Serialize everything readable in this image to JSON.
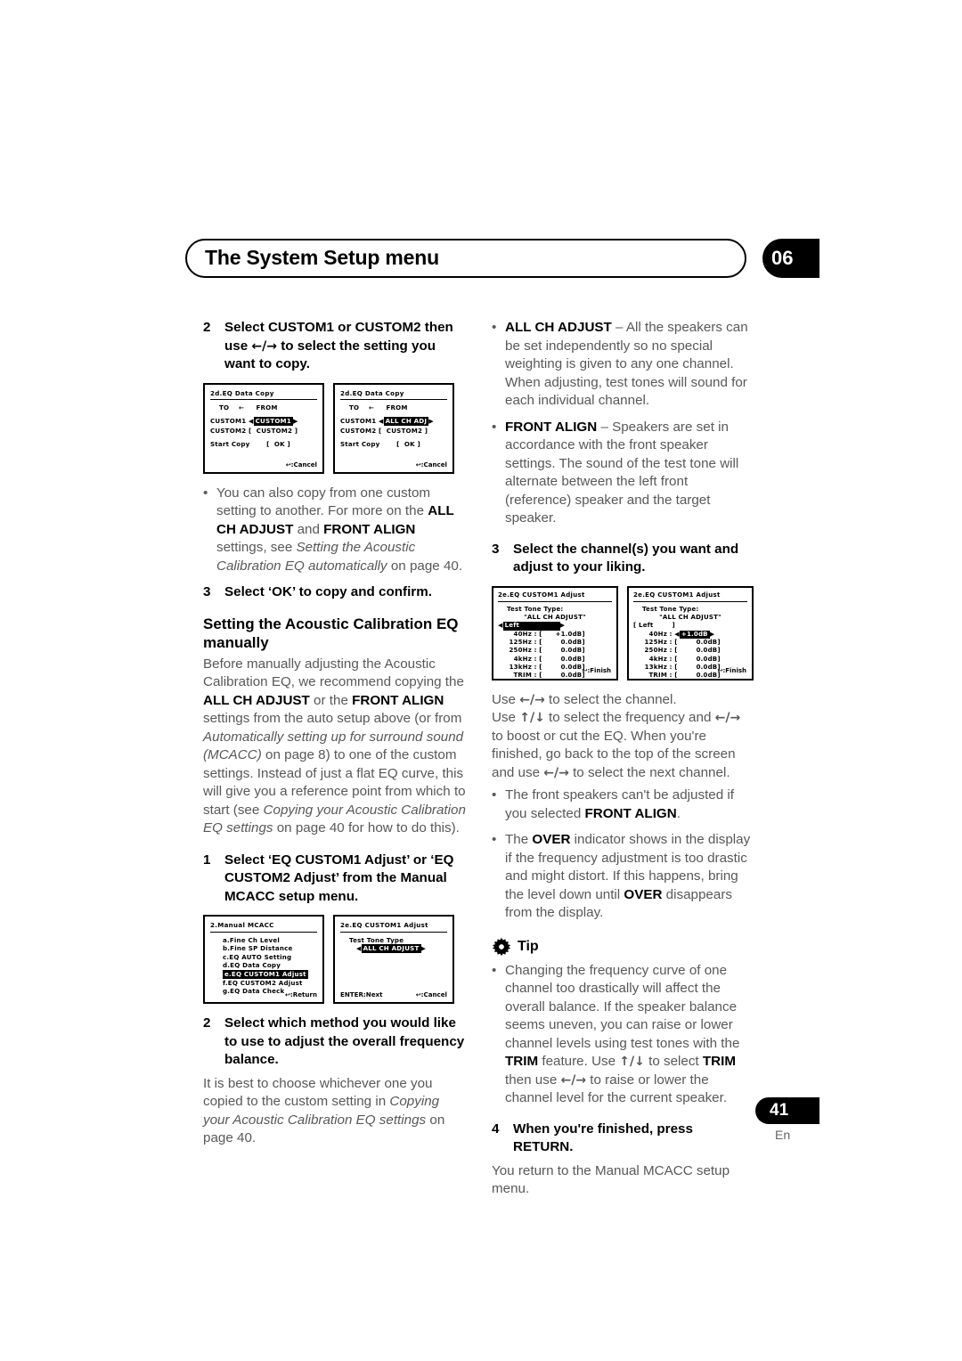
{
  "header": {
    "title": "The System Setup menu",
    "chapter": "06"
  },
  "footer": {
    "page_number": "41",
    "language": "En"
  },
  "left_column": {
    "step2": {
      "number": "2",
      "text_a": "Select CUSTOM1 or CUSTOM2 then use ",
      "arrows": "←/→",
      "text_b": " to select the setting you want to copy."
    },
    "figure_eq_data_copy": {
      "screen1": {
        "title": "2d.EQ Data Copy",
        "header_row": "TO    ←     FROM",
        "row1_label": "CUSTOM1",
        "row1_value": "CUSTOM1",
        "row2_label": "CUSTOM2",
        "row2_value": "CUSTOM2",
        "start_label": "Start Copy",
        "start_value": "OK",
        "footer": "↩:Cancel"
      },
      "screen2": {
        "title": "2d.EQ Data Copy",
        "header_row": "TO    ←     FROM",
        "row1_label": "CUSTOM1",
        "row1_value": "ALL CH ADJ",
        "row2_label": "CUSTOM2",
        "row2_value": "CUSTOM2",
        "start_label": "Start Copy",
        "start_value": "OK",
        "footer": "↩:Cancel"
      }
    },
    "bullet1": {
      "part1": "You can also copy from one custom setting to another. For more on the ",
      "bold1": "ALL CH ADJUST",
      "part2": " and ",
      "bold2": "FRONT ALIGN",
      "part3": " settings, see ",
      "italic1": "Setting the Acoustic Calibration EQ automatically",
      "part4": " on page 40."
    },
    "step3": {
      "number": "3",
      "text": "Select ‘OK’ to copy and confirm."
    },
    "heading_manual": "Setting the Acoustic Calibration EQ manually",
    "body_manual": {
      "part1": "Before manually adjusting the Acoustic Calibration EQ, we recommend copying the ",
      "bold1": "ALL CH ADJUST",
      "part2": " or the ",
      "bold2": "FRONT ALIGN",
      "part3": " settings from the auto setup above (or from ",
      "italic1": "Automatically setting up for surround sound (MCACC)",
      "part4": " on page 8) to one of the custom settings. Instead of just a flat EQ curve, this will give you a reference point from which to start (see ",
      "italic2": "Copying your Acoustic Calibration EQ settings",
      "part5": " on page 40 for how to do this)."
    },
    "step1b": {
      "number": "1",
      "text": "Select ‘EQ CUSTOM1 Adjust’ or ‘EQ CUSTOM2 Adjust’ from the Manual MCACC setup menu."
    },
    "figure_manual_mcacc": {
      "screen1": {
        "title": "2.Manual MCACC",
        "items": [
          "a.Fine Ch Level",
          "b.Fine SP Distance",
          "c.EQ AUTO Setting",
          "d.EQ Data Copy",
          "e.EQ CUSTOM1 Adjust",
          "f.EQ CUSTOM2 Adjust",
          "g.EQ Data Check"
        ],
        "selected_index": 4,
        "footer": "↩:Return"
      },
      "screen2": {
        "title": "2e.EQ CUSTOM1 Adjust",
        "label": "Test Tone Type",
        "value": "ALL CH ADJUST",
        "footer_left": "ENTER:Next",
        "footer_right": "↩:Cancel"
      }
    },
    "step2b": {
      "number": "2",
      "text": "Select which method you would like to use to adjust the overall frequency balance."
    },
    "body_step2b": {
      "part1": "It is best to choose whichever one you copied to the custom setting in ",
      "italic1": "Copying your Acoustic Calibration EQ settings",
      "part2": " on page 40."
    }
  },
  "right_column": {
    "bullet_allch": {
      "bold": "ALL CH ADJUST",
      "text": " – All the speakers can be set independently so no special weighting is given to any one channel. When adjusting, test tones will sound for each individual channel."
    },
    "bullet_frontalign": {
      "bold": "FRONT ALIGN",
      "text": " – Speakers are set in accordance with the front speaker settings. The sound of the test tone will alternate between the left front (reference) speaker and the target speaker."
    },
    "step3": {
      "number": "3",
      "text": "Select the channel(s) you want and adjust to your liking."
    },
    "figure_eq_adjust": {
      "screen1": {
        "title": "2e.EQ CUSTOM1 Adjust",
        "label": "Test Tone Type:",
        "type_value": "\"ALL CH ADJUST\"",
        "channel": "Left",
        "bands": [
          {
            "freq": "40Hz",
            "value": "+1.0dB"
          },
          {
            "freq": "125Hz",
            "value": "0.0dB"
          },
          {
            "freq": "250Hz",
            "value": "0.0dB"
          },
          {
            "freq": "4kHz",
            "value": "0.0dB"
          },
          {
            "freq": "13kHz",
            "value": "0.0dB"
          },
          {
            "freq": "TRIM",
            "value": "0.0dB"
          }
        ],
        "selected": "channel",
        "footer": "↩:Finish"
      },
      "screen2": {
        "title": "2e.EQ CUSTOM1 Adjust",
        "label": "Test Tone Type:",
        "type_value": "\"ALL CH ADJUST\"",
        "channel": "Left",
        "bands": [
          {
            "freq": "40Hz",
            "value": "+1.0dB"
          },
          {
            "freq": "125Hz",
            "value": "0.0dB"
          },
          {
            "freq": "250Hz",
            "value": "0.0dB"
          },
          {
            "freq": "4kHz",
            "value": "0.0dB"
          },
          {
            "freq": "13kHz",
            "value": "0.0dB"
          },
          {
            "freq": "TRIM",
            "value": "0.0dB"
          }
        ],
        "selected": "band0",
        "footer": "↩:Finish"
      }
    },
    "use_line1": {
      "part1": "Use ",
      "arrows": "←/→",
      "part2": " to select the channel."
    },
    "use_line2": {
      "part1": "Use ",
      "arrows1": "↑/↓",
      "part2": " to select the frequency and ",
      "arrows2": "←/→",
      "part3": " to boost or cut the EQ. When you're finished, go back to the top of the screen and use ",
      "arrows3": "←/→",
      "part4": " to select the next channel."
    },
    "bullet_front": {
      "part1": "The front speakers can't be adjusted if you selected ",
      "bold1": "FRONT ALIGN",
      "part2": "."
    },
    "bullet_over": {
      "part1": "The ",
      "bold1": "OVER",
      "part2": " indicator shows in the display if the frequency adjustment is too drastic and might distort. If this happens, bring the level down until ",
      "bold2": "OVER",
      "part3": " disappears from the display."
    },
    "tip": {
      "label": "Tip",
      "icon": "gear-icon",
      "bullet": {
        "part1": "Changing the frequency curve of one channel too drastically will affect the overall balance. If the speaker balance seems uneven, you can raise or lower channel levels using test tones with the ",
        "bold1": "TRIM",
        "part2": " feature. Use ",
        "arrows1": "↑/↓",
        "part3": " to select ",
        "bold2": "TRIM",
        "part4": " then use ",
        "arrows2": "←/→",
        "part5": " to raise or lower the channel level for the current speaker."
      }
    },
    "step4": {
      "number": "4",
      "text": "When you're finished, press RETURN."
    },
    "body_step4": "You return to the Manual MCACC setup menu."
  }
}
